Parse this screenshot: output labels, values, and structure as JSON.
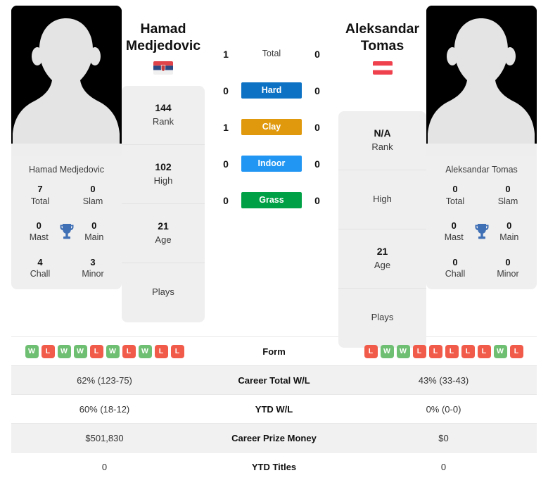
{
  "players": {
    "left": {
      "name_line1": "Hamad",
      "name_line2": "Medjedovic",
      "full_name": "Hamad Medjedovic",
      "flag": "serbia-flag",
      "rank": "144",
      "rank_label": "Rank",
      "high": "102",
      "high_label": "High",
      "age": "21",
      "age_label": "Age",
      "plays_label": "Plays",
      "plays_value": "",
      "titles": {
        "total": "7",
        "total_label": "Total",
        "slam": "0",
        "slam_label": "Slam",
        "mast": "0",
        "mast_label": "Mast",
        "main": "0",
        "main_label": "Main",
        "chall": "4",
        "chall_label": "Chall",
        "minor": "3",
        "minor_label": "Minor"
      },
      "form": [
        "W",
        "L",
        "W",
        "W",
        "L",
        "W",
        "L",
        "W",
        "L",
        "L"
      ],
      "career_wl": "62% (123-75)",
      "ytd_wl": "60% (18-12)",
      "career_prize": "$501,830",
      "ytd_titles": "0"
    },
    "right": {
      "name_line1": "Aleksandar",
      "name_line2": "Tomas",
      "full_name": "Aleksandar Tomas",
      "flag": "austria-flag",
      "rank": "N/A",
      "rank_label": "Rank",
      "high": "",
      "high_label": "High",
      "age": "21",
      "age_label": "Age",
      "plays_label": "Plays",
      "plays_value": "",
      "titles": {
        "total": "0",
        "total_label": "Total",
        "slam": "0",
        "slam_label": "Slam",
        "mast": "0",
        "mast_label": "Mast",
        "main": "0",
        "main_label": "Main",
        "chall": "0",
        "chall_label": "Chall",
        "minor": "0",
        "minor_label": "Minor"
      },
      "form": [
        "L",
        "W",
        "W",
        "L",
        "L",
        "L",
        "L",
        "L",
        "W",
        "L"
      ],
      "career_wl": "43% (33-43)",
      "ytd_wl": "0% (0-0)",
      "career_prize": "$0",
      "ytd_titles": "0"
    }
  },
  "h2h": [
    {
      "label": "Total",
      "left": "1",
      "right": "0",
      "color": "",
      "style": "plain"
    },
    {
      "label": "Hard",
      "left": "0",
      "right": "0",
      "color": "#0d72c4",
      "style": "badge"
    },
    {
      "label": "Clay",
      "left": "1",
      "right": "0",
      "color": "#e0990c",
      "style": "badge"
    },
    {
      "label": "Indoor",
      "left": "0",
      "right": "0",
      "color": "#2196f3",
      "style": "badge"
    },
    {
      "label": "Grass",
      "left": "0",
      "right": "0",
      "color": "#00a146",
      "style": "badge"
    }
  ],
  "table_labels": {
    "form": "Form",
    "career_total_wl": "Career Total W/L",
    "ytd_wl": "YTD W/L",
    "career_prize_money": "Career Prize Money",
    "ytd_titles": "YTD Titles"
  },
  "colors": {
    "win_badge": "#6fbf73",
    "loss_badge": "#f15b4a",
    "card_background": "#efefef",
    "row_shade": "#f1f1f1",
    "trophy": "#3f6fb5"
  }
}
